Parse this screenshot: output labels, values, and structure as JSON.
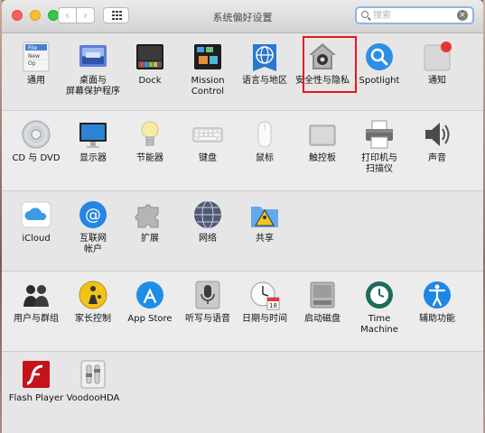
{
  "window": {
    "title": "系统偏好设置"
  },
  "toolbar": {
    "back_symbol": "‹",
    "forward_symbol": "›"
  },
  "search": {
    "placeholder": "搜索",
    "value": ""
  },
  "colors": {
    "highlight": "#e8161e",
    "search_focus": "#8db6e4"
  },
  "rows": [
    {
      "items": [
        {
          "label": "通用",
          "icon": "general-icon"
        },
        {
          "label": "桌面与\n屏幕保护程序",
          "icon": "desktop-screensaver-icon"
        },
        {
          "label": "Dock",
          "icon": "dock-icon"
        },
        {
          "label": "Mission\nControl",
          "icon": "mission-control-icon"
        },
        {
          "label": "语言与地区",
          "icon": "language-region-icon"
        },
        {
          "label": "安全性与隐私",
          "icon": "security-privacy-icon"
        },
        {
          "label": "Spotlight",
          "icon": "spotlight-icon"
        },
        {
          "label": "通知",
          "icon": "notifications-icon"
        }
      ]
    },
    {
      "items": [
        {
          "label": "CD 与 DVD",
          "icon": "cd-dvd-icon"
        },
        {
          "label": "显示器",
          "icon": "displays-icon"
        },
        {
          "label": "节能器",
          "icon": "energy-saver-icon"
        },
        {
          "label": "键盘",
          "icon": "keyboard-icon"
        },
        {
          "label": "鼠标",
          "icon": "mouse-icon"
        },
        {
          "label": "触控板",
          "icon": "trackpad-icon"
        },
        {
          "label": "打印机与\n扫描仪",
          "icon": "printers-scanners-icon"
        },
        {
          "label": "声音",
          "icon": "sound-icon"
        }
      ]
    },
    {
      "items": [
        {
          "label": "iCloud",
          "icon": "icloud-icon"
        },
        {
          "label": "互联网\n帐户",
          "icon": "internet-accounts-icon"
        },
        {
          "label": "扩展",
          "icon": "extensions-icon"
        },
        {
          "label": "网络",
          "icon": "network-icon"
        },
        {
          "label": "共享",
          "icon": "sharing-icon"
        }
      ]
    },
    {
      "items": [
        {
          "label": "用户与群组",
          "icon": "users-groups-icon"
        },
        {
          "label": "家长控制",
          "icon": "parental-controls-icon"
        },
        {
          "label": "App Store",
          "icon": "app-store-icon"
        },
        {
          "label": "听写与语音",
          "icon": "dictation-speech-icon"
        },
        {
          "label": "日期与时间",
          "icon": "date-time-icon"
        },
        {
          "label": "启动磁盘",
          "icon": "startup-disk-icon"
        },
        {
          "label": "Time Machine",
          "icon": "time-machine-icon"
        },
        {
          "label": "辅助功能",
          "icon": "accessibility-icon"
        }
      ]
    },
    {
      "items": [
        {
          "label": "Flash Player",
          "icon": "flash-player-icon"
        },
        {
          "label": "VoodooHDA",
          "icon": "voodoohda-icon"
        }
      ]
    }
  ],
  "icon_text": {
    "general": "File\nNew\nOp",
    "calendar_day": "18",
    "dock_app_color": "#d94a3c"
  }
}
